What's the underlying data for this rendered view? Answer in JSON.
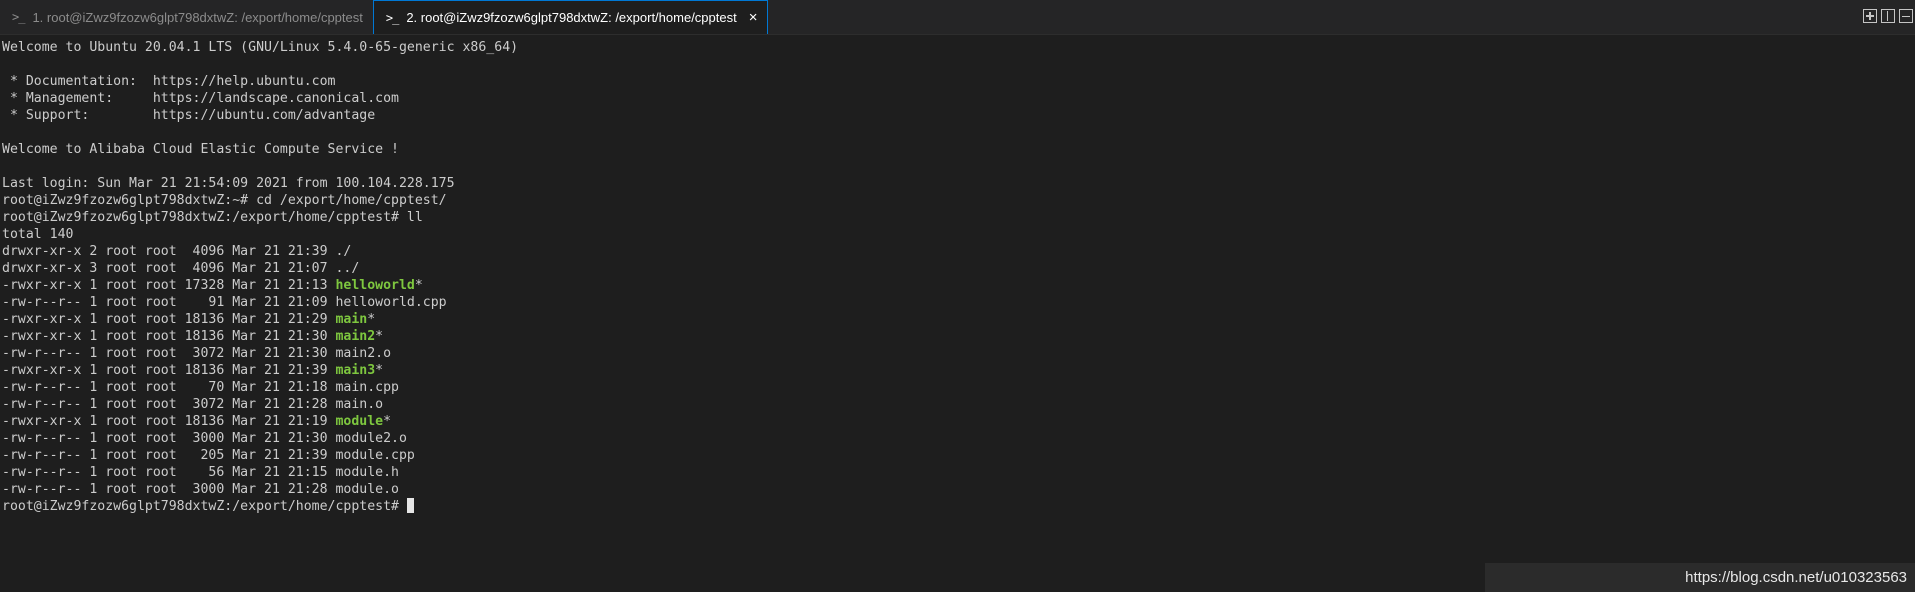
{
  "tabs": [
    {
      "icon": ">_",
      "label": "1. root@iZwz9fzozw6glpt798dxtwZ: /export/home/cpptest"
    },
    {
      "icon": ">_",
      "label": "2. root@iZwz9fzozw6glpt798dxtwZ: /export/home/cpptest",
      "close": "×"
    }
  ],
  "header_lines": [
    "Welcome to Ubuntu 20.04.1 LTS (GNU/Linux 5.4.0-65-generic x86_64)",
    "",
    " * Documentation:  https://help.ubuntu.com",
    " * Management:     https://landscape.canonical.com",
    " * Support:        https://ubuntu.com/advantage",
    "",
    "Welcome to Alibaba Cloud Elastic Compute Service !",
    "",
    "Last login: Sun Mar 21 21:54:09 2021 from 100.104.228.175",
    "root@iZwz9fzozw6glpt798dxtwZ:~# cd /export/home/cpptest/",
    "root@iZwz9fzozw6glpt798dxtwZ:/export/home/cpptest# ll",
    "total 140"
  ],
  "listing": [
    {
      "meta": "drwxr-xr-x 2 root root  4096 Mar 21 21:39 ",
      "name": "./",
      "suffix": ""
    },
    {
      "meta": "drwxr-xr-x 3 root root  4096 Mar 21 21:07 ",
      "name": "../",
      "suffix": ""
    },
    {
      "meta": "-rwxr-xr-x 1 root root 17328 Mar 21 21:13 ",
      "name": "helloworld",
      "suffix": "*"
    },
    {
      "meta": "-rw-r--r-- 1 root root    91 Mar 21 21:09 ",
      "name": "helloworld.cpp",
      "suffix": ""
    },
    {
      "meta": "-rwxr-xr-x 1 root root 18136 Mar 21 21:29 ",
      "name": "main",
      "suffix": "*"
    },
    {
      "meta": "-rwxr-xr-x 1 root root 18136 Mar 21 21:30 ",
      "name": "main2",
      "suffix": "*"
    },
    {
      "meta": "-rw-r--r-- 1 root root  3072 Mar 21 21:30 ",
      "name": "main2.o",
      "suffix": ""
    },
    {
      "meta": "-rwxr-xr-x 1 root root 18136 Mar 21 21:39 ",
      "name": "main3",
      "suffix": "*"
    },
    {
      "meta": "-rw-r--r-- 1 root root    70 Mar 21 21:18 ",
      "name": "main.cpp",
      "suffix": ""
    },
    {
      "meta": "-rw-r--r-- 1 root root  3072 Mar 21 21:28 ",
      "name": "main.o",
      "suffix": ""
    },
    {
      "meta": "-rwxr-xr-x 1 root root 18136 Mar 21 21:19 ",
      "name": "module",
      "suffix": "*"
    },
    {
      "meta": "-rw-r--r-- 1 root root  3000 Mar 21 21:30 ",
      "name": "module2.o",
      "suffix": ""
    },
    {
      "meta": "-rw-r--r-- 1 root root   205 Mar 21 21:39 ",
      "name": "module.cpp",
      "suffix": ""
    },
    {
      "meta": "-rw-r--r-- 1 root root    56 Mar 21 21:15 ",
      "name": "module.h",
      "suffix": ""
    },
    {
      "meta": "-rw-r--r-- 1 root root  3000 Mar 21 21:28 ",
      "name": "module.o",
      "suffix": ""
    }
  ],
  "prompt": "root@iZwz9fzozw6glpt798dxtwZ:/export/home/cpptest# ",
  "watermark": "https://blog.csdn.net/u010323563",
  "colors": {
    "background": "#1e1e1e",
    "executable": "#7ec73f",
    "active_tab_border": "#0078d4"
  },
  "icons": [
    "terminal-icon",
    "close-icon",
    "new-terminal-icon",
    "split-terminal-icon",
    "minimize-terminal-icon"
  ]
}
